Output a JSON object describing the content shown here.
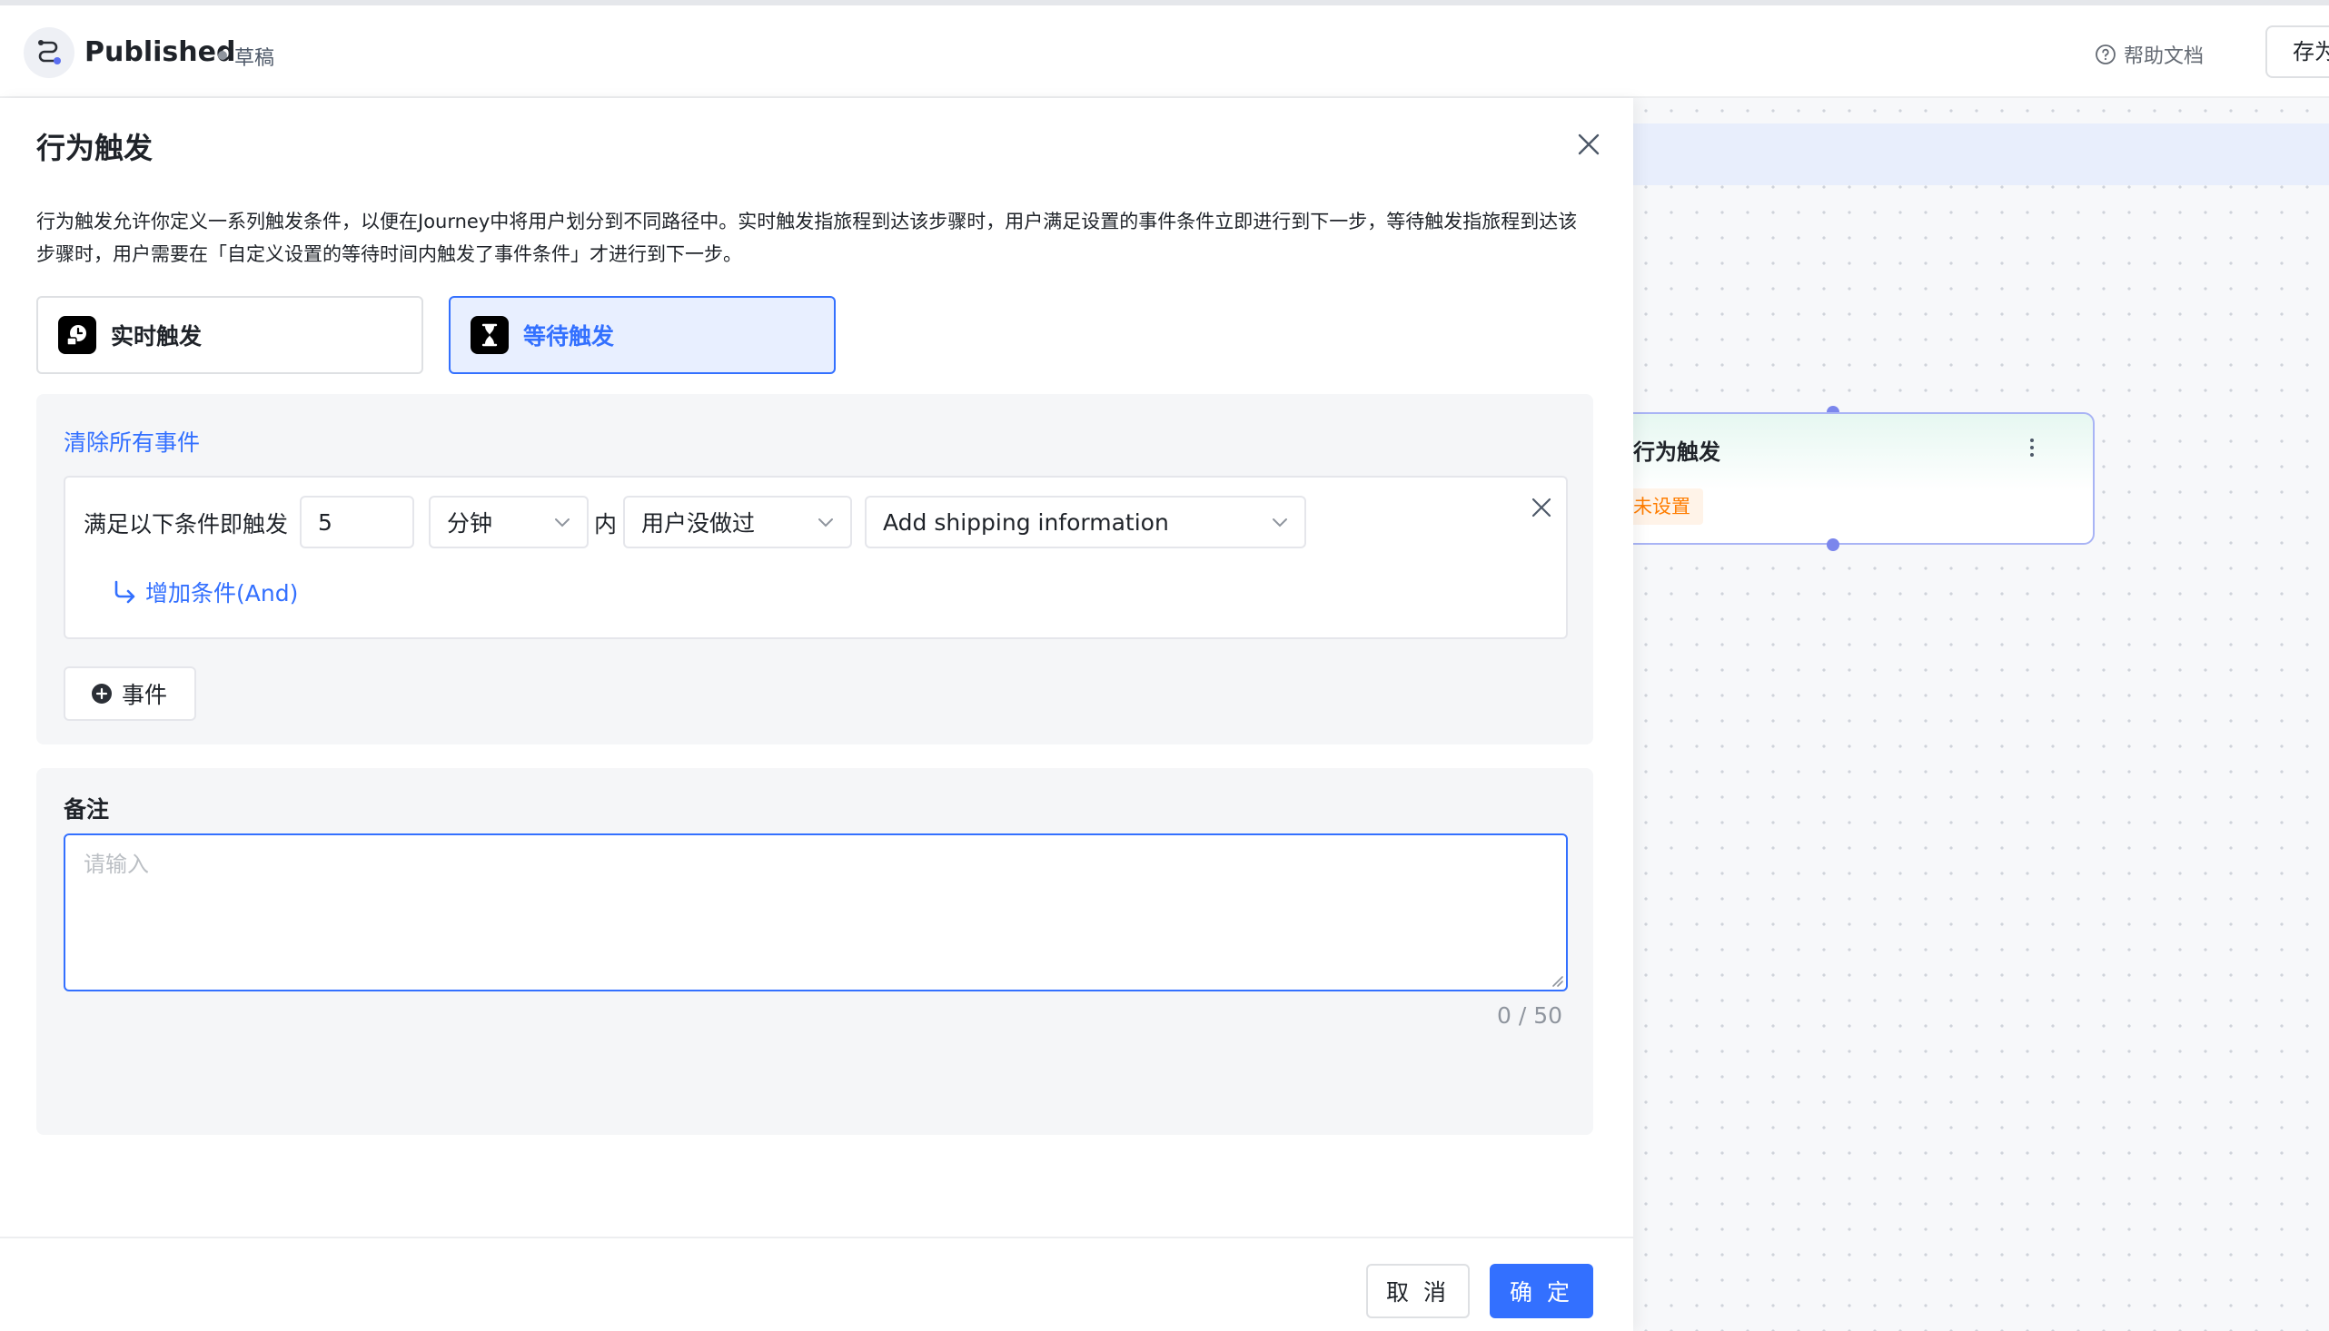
{
  "header": {
    "app_title": "Published",
    "status": "草稿",
    "help_label": "帮助文档",
    "save_label": "存为"
  },
  "canvas": {
    "node_title": "行为触发",
    "node_tag": "未设置"
  },
  "drawer": {
    "title": "行为触发",
    "description": "行为触发允许你定义一系列触发条件，以便在Journey中将用户划分到不同路径中。实时触发指旅程到达该步骤时，用户满足设置的事件条件立即进行到下一步，等待触发指旅程到达该步骤时，用户需要在「自定义设置的等待时间内触发了事件条件」才进行到下一步。",
    "modes": [
      {
        "label": "实时触发",
        "icon": "realtime-clock-icon",
        "selected": false
      },
      {
        "label": "等待触发",
        "icon": "hourglass-icon",
        "selected": true
      }
    ],
    "events": {
      "clear_all_label": "清除所有事件",
      "condition": {
        "prefix": "满足以下条件即触发",
        "amount": "5",
        "unit": "分钟",
        "within": "内",
        "action": "用户没做过",
        "event": "Add shipping information"
      },
      "add_and_label": "增加条件(And)",
      "add_event_label": "事件"
    },
    "notes": {
      "title": "备注",
      "placeholder": "请输入",
      "value": "",
      "counter": "0 / 50"
    },
    "footer": {
      "cancel_label": "取 消",
      "confirm_label": "确 定"
    }
  },
  "colors": {
    "primary": "#3370ff",
    "warning": "#ff7d00",
    "node_border": "#a9b4f5"
  }
}
